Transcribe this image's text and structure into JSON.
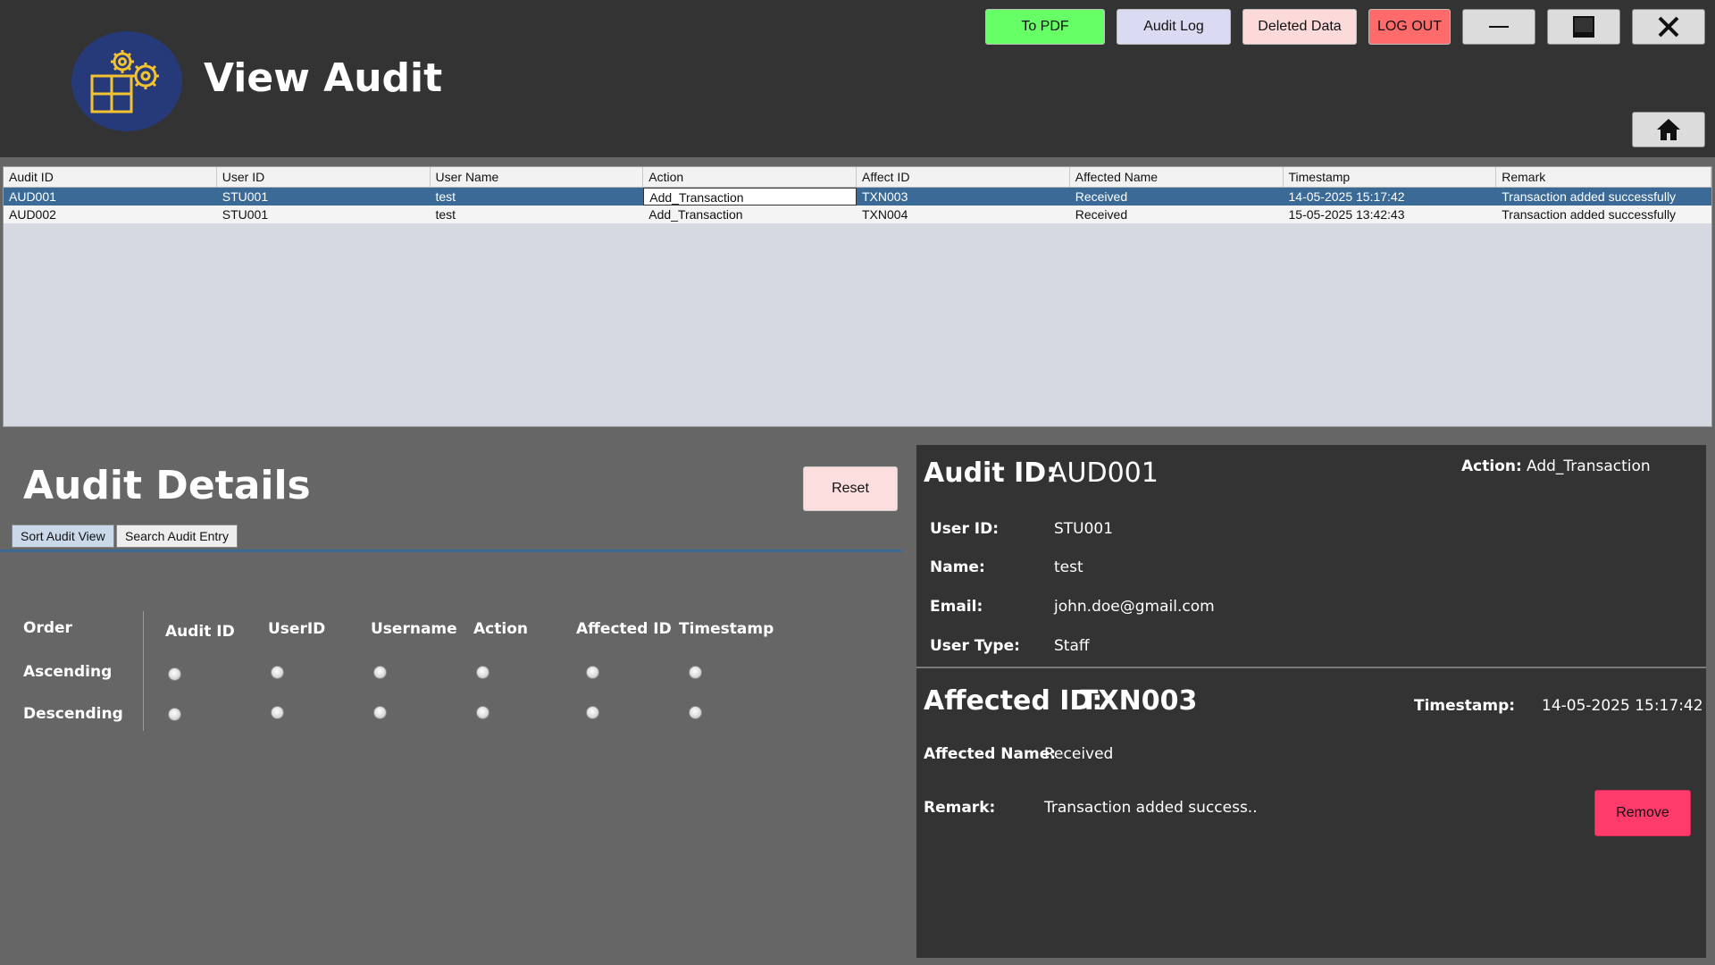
{
  "header": {
    "title": "View Audit"
  },
  "toolbar": {
    "to_pdf": "To PDF",
    "audit_log": "Audit Log",
    "deleted_data": "Deleted Data",
    "log_out": "LOG OUT"
  },
  "table": {
    "columns": [
      "Audit ID",
      "User ID",
      "User Name",
      "Action",
      "Affect ID",
      "Affected Name",
      "Timestamp",
      "Remark"
    ],
    "rows": [
      [
        "AUD001",
        "STU001",
        "test",
        "Add_Transaction",
        "TXN003",
        "Received",
        "14-05-2025 15:17:42",
        "Transaction added successfully"
      ],
      [
        "AUD002",
        "STU001",
        "test",
        "Add_Transaction",
        "TXN004",
        "Received",
        "15-05-2025 13:42:43",
        "Transaction added successfully"
      ]
    ]
  },
  "details": {
    "title": "Audit Details",
    "reset": "Reset",
    "tabs": [
      "Sort Audit View",
      "Search Audit Entry"
    ],
    "sort": {
      "order": "Order",
      "ascending": "Ascending",
      "descending": "Descending",
      "columns": [
        "Audit ID",
        "UserID",
        "Username",
        "Action",
        "Affected ID",
        "Timestamp"
      ]
    }
  },
  "panel": {
    "audit_id_label": "Audit ID:",
    "audit_id": "AUD001",
    "action_label": "Action:",
    "action": "Add_Transaction",
    "user_id_label": "User ID:",
    "user_id": "STU001",
    "name_label": "Name:",
    "name": "test",
    "email_label": "Email:",
    "email": "john.doe@gmail.com",
    "user_type_label": "User Type:",
    "user_type": "Staff",
    "affected_id_label": "Affected ID:",
    "affected_id": "TXN003",
    "timestamp_label": "Timestamp:",
    "timestamp": "14-05-2025 15:17:42",
    "affected_name_label": "Affected Name:",
    "affected_name": "Received",
    "remark_label": "Remark:",
    "remark": "Transaction added success..",
    "remove": "Remove"
  }
}
